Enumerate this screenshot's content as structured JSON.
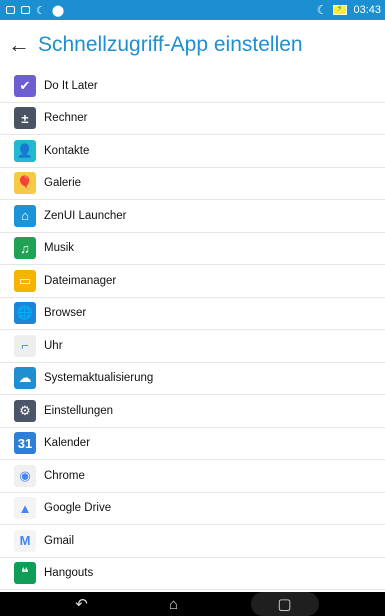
{
  "status_bar": {
    "time": "03:43",
    "accent_color": "#1c8fd0",
    "icons": [
      "notification-icon",
      "message-icon",
      "moon-icon",
      "location-icon",
      "do-not-disturb-icon",
      "battery-charging-icon"
    ]
  },
  "header": {
    "back_icon": "←",
    "title": "Schnellzugriff-App einstellen"
  },
  "apps": [
    {
      "label": "Do It Later",
      "icon": "do-it-later-icon",
      "glyph": "✔",
      "color": "#6b5fd1"
    },
    {
      "label": "Rechner",
      "icon": "calculator-icon",
      "glyph": "±",
      "color": "#4a5363"
    },
    {
      "label": "Kontakte",
      "icon": "contacts-icon",
      "glyph": "👤",
      "color": "#20b9d0"
    },
    {
      "label": "Galerie",
      "icon": "gallery-icon",
      "glyph": "🎈",
      "color": "#f7c945"
    },
    {
      "label": "ZenUI Launcher",
      "icon": "launcher-icon",
      "glyph": "⌂",
      "color": "#1c93d8"
    },
    {
      "label": "Musik",
      "icon": "music-icon",
      "glyph": "♫",
      "color": "#20a153"
    },
    {
      "label": "Dateimanager",
      "icon": "file-manager-icon",
      "glyph": "▭",
      "color": "#f5b400"
    },
    {
      "label": "Browser",
      "icon": "browser-icon",
      "glyph": "🌐",
      "color": "#1d84d6"
    },
    {
      "label": "Uhr",
      "icon": "clock-icon",
      "glyph": "⌐",
      "color": "#eeeeee"
    },
    {
      "label": "Systemaktualisierung",
      "icon": "system-update-icon",
      "glyph": "☁",
      "color": "#1f8fd0"
    },
    {
      "label": "Einstellungen",
      "icon": "settings-icon",
      "glyph": "⚙",
      "color": "#4b5568"
    },
    {
      "label": "Kalender",
      "icon": "calendar-icon",
      "glyph": "31",
      "color": "#2f7fd6"
    },
    {
      "label": "Chrome",
      "icon": "chrome-icon",
      "glyph": "◉",
      "color": "#f0f0f0"
    },
    {
      "label": "Google Drive",
      "icon": "google-drive-icon",
      "glyph": "▲",
      "color": "#f4f4f4"
    },
    {
      "label": "Gmail",
      "icon": "gmail-icon",
      "glyph": "M",
      "color": "#f4f4f4"
    },
    {
      "label": "Hangouts",
      "icon": "hangouts-icon",
      "glyph": "❝",
      "color": "#0f9d58"
    }
  ],
  "nav_bar": {
    "back": "↶",
    "home": "⌂",
    "recents": "▢"
  }
}
